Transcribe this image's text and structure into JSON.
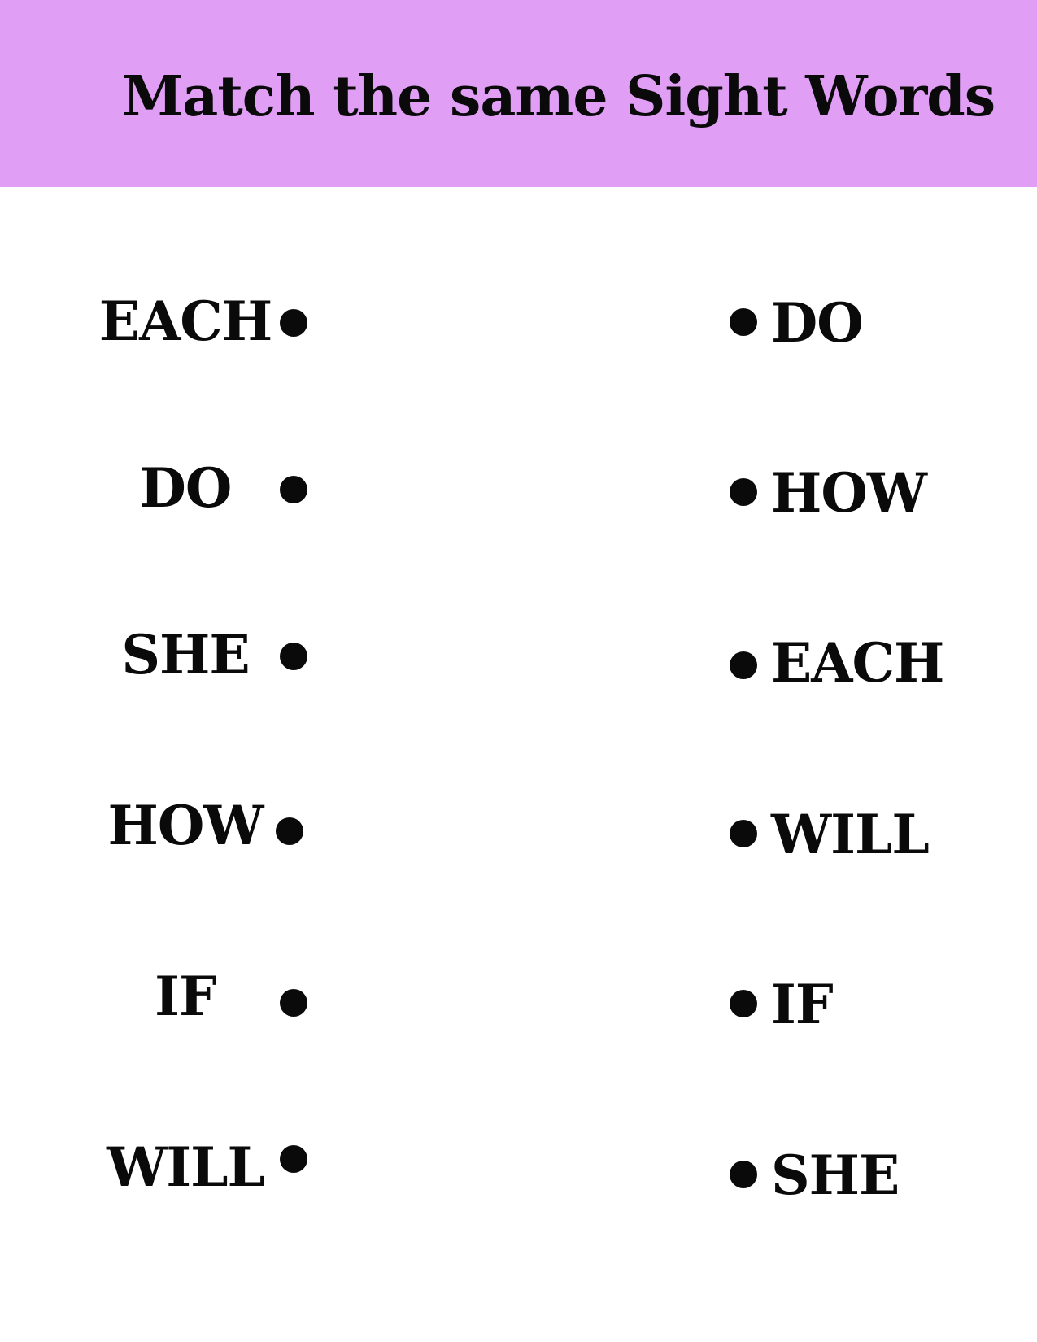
{
  "header": {
    "title": "Match the same Sight Words",
    "background_color": "#e09ef5"
  },
  "worksheet": {
    "left_words": [
      "EACH",
      "DO",
      "SHE",
      "HOW",
      "IF",
      "WILL"
    ],
    "right_words": [
      "DO",
      "HOW",
      "EACH",
      "WILL",
      "IF",
      "SHE"
    ]
  }
}
